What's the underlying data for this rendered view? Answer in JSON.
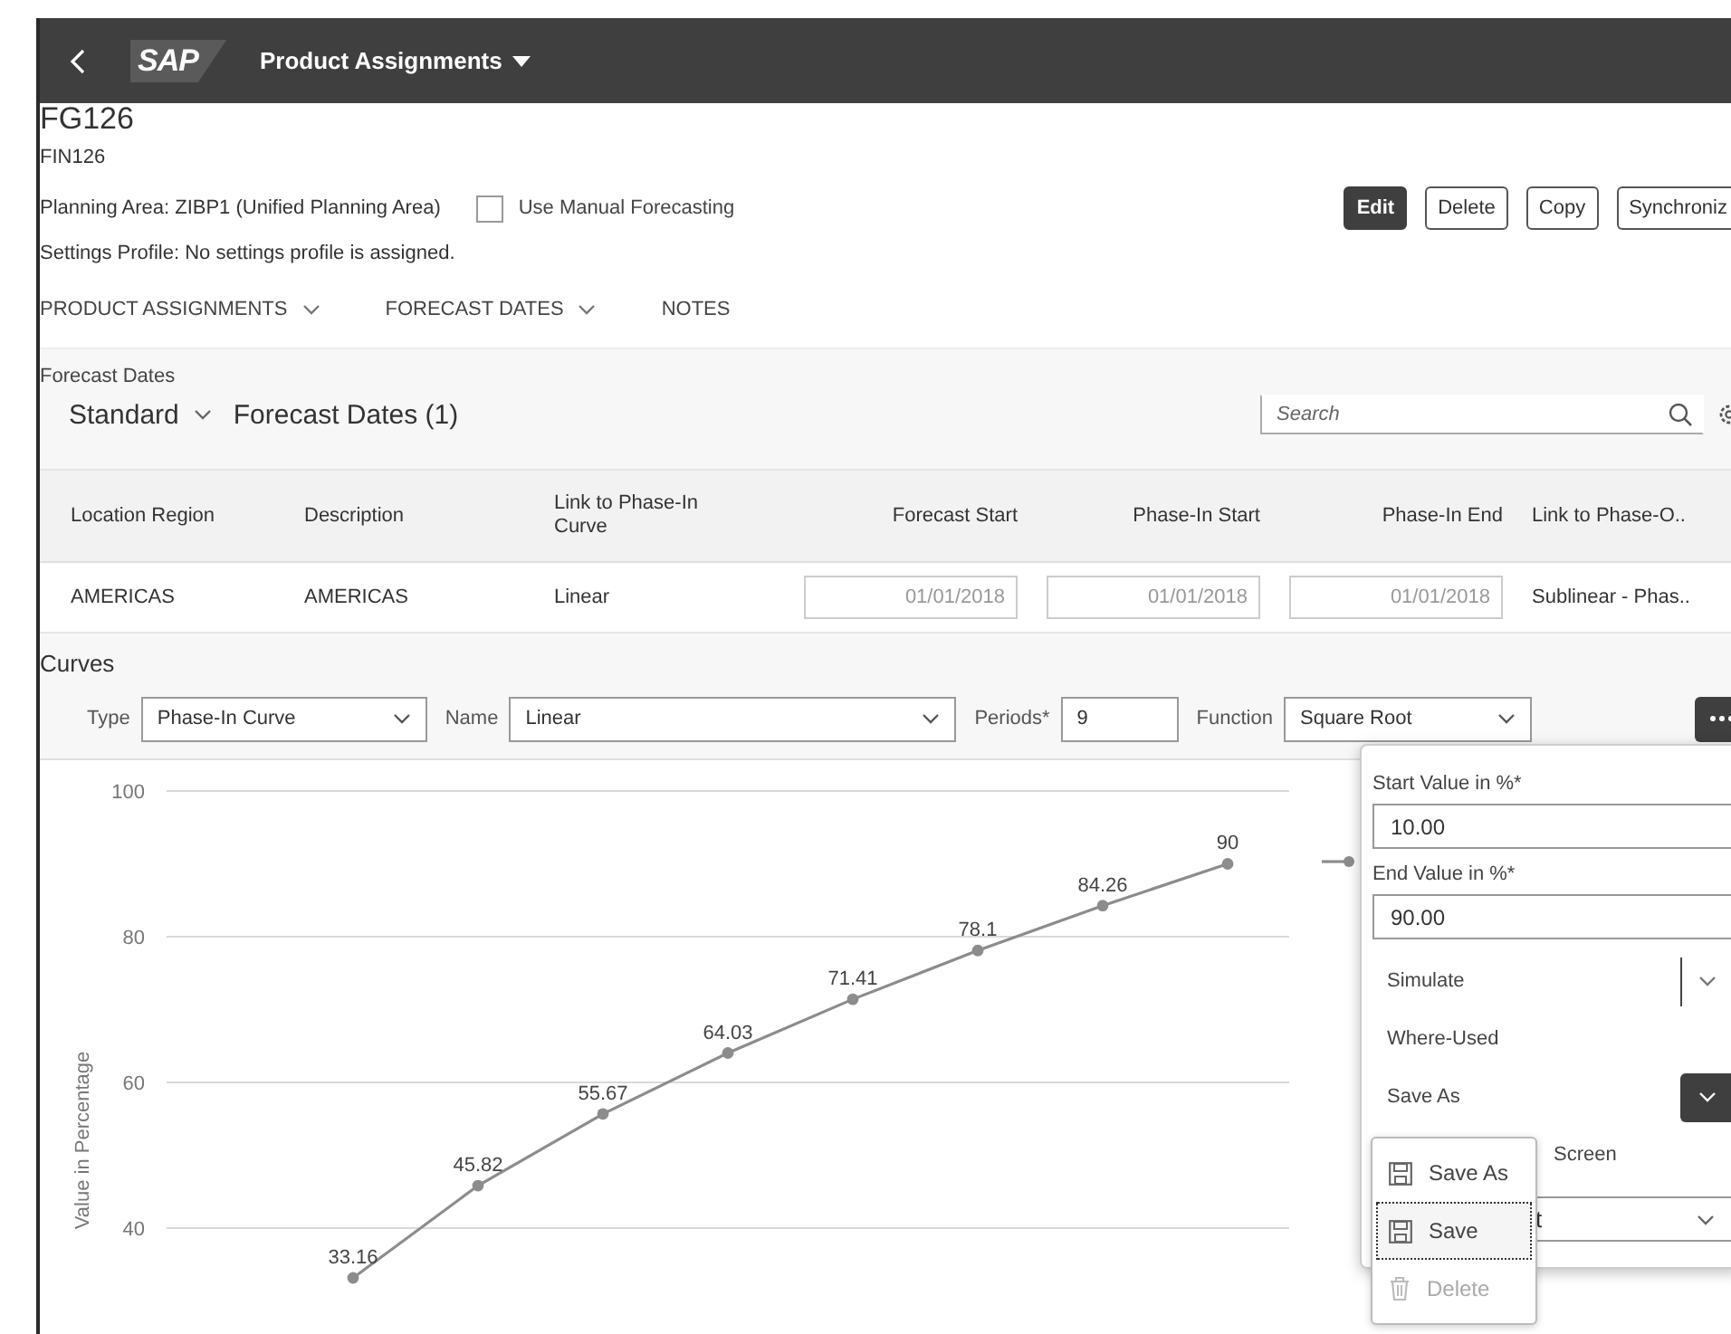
{
  "shell_bar": {
    "logo": "SAP",
    "title": "Product Assignments"
  },
  "object": {
    "title": "FG126",
    "subtitle": "FIN126",
    "planning_area": "Planning Area: ZIBP1 (Unified Planning Area)",
    "manual_forecasting": {
      "label": "Use Manual Forecasting",
      "checked": false
    },
    "settings_profile": "Settings Profile: No settings profile is assigned."
  },
  "actions": [
    {
      "label": "Edit",
      "kind": "emphasized"
    },
    {
      "label": "Delete",
      "kind": "default"
    },
    {
      "label": "Copy",
      "kind": "default"
    },
    {
      "label": "Synchroniz",
      "kind": "cut"
    }
  ],
  "section_tabs": [
    {
      "label": "PRODUCT ASSIGNMENTS",
      "has_menu": true
    },
    {
      "label": "FORECAST DATES",
      "has_menu": true
    },
    {
      "label": "NOTES",
      "has_menu": false
    }
  ],
  "forecast_dates": {
    "heading": "Forecast Dates",
    "variant": "Standard",
    "table_title": "Forecast Dates (1)",
    "search": {
      "placeholder": "Search"
    },
    "columns": [
      {
        "label": "Location Region",
        "kind": "text"
      },
      {
        "label": "Description",
        "kind": "text"
      },
      {
        "label": "Link to Phase-In Curve",
        "kind": "text"
      },
      {
        "label": "Forecast Start",
        "kind": "date"
      },
      {
        "label": "Phase-In Start",
        "kind": "date"
      },
      {
        "label": "Phase-In End",
        "kind": "date"
      },
      {
        "label": "Link to Phase-O..",
        "kind": "text"
      }
    ],
    "rows": [
      [
        "AMERICAS",
        "AMERICAS",
        "Linear",
        "01/01/2018",
        "01/01/2018",
        "01/01/2018",
        "Sublinear - Phas.."
      ]
    ]
  },
  "curves": {
    "heading": "Curves",
    "fields": [
      {
        "label": "Type",
        "value": "Phase-In Curve",
        "kind": "select"
      },
      {
        "label": "Name",
        "value": "Linear",
        "kind": "combo"
      },
      {
        "label": "Periods*",
        "value": "9",
        "kind": "input"
      },
      {
        "label": "Function",
        "value": "Square Root",
        "kind": "select"
      }
    ],
    "chart_data": {
      "type": "line",
      "ylabel": "Value in Percentage",
      "ylim": [
        26.2,
        100
      ],
      "yticks": [
        40,
        60,
        80,
        100
      ],
      "grid": true,
      "data_labels": true,
      "series": [
        {
          "color": "#8c8c8c",
          "marker": "circle",
          "values": [
            null,
            33.16,
            45.82,
            55.67,
            64.03,
            71.41,
            78.1,
            84.26,
            90
          ]
        }
      ]
    },
    "popover": {
      "fields": [
        {
          "label": "Start Value in %*",
          "value": "10.00"
        },
        {
          "label": "End Value in %*",
          "value": "90.00"
        }
      ],
      "actions": [
        {
          "label": "Simulate",
          "kind": "split"
        },
        {
          "label": "Where-Used",
          "kind": "plain"
        },
        {
          "label": "Save As",
          "kind": "split_active"
        },
        {
          "label": "Screen",
          "kind": "covered"
        }
      ],
      "select": {
        "value": "t"
      }
    },
    "menu": [
      {
        "label": "Save As",
        "kind": "save",
        "focused": false,
        "disabled": false
      },
      {
        "label": "Save",
        "kind": "save",
        "focused": true,
        "disabled": false
      },
      {
        "label": "Delete",
        "kind": "delete",
        "focused": false,
        "disabled": true
      }
    ]
  }
}
